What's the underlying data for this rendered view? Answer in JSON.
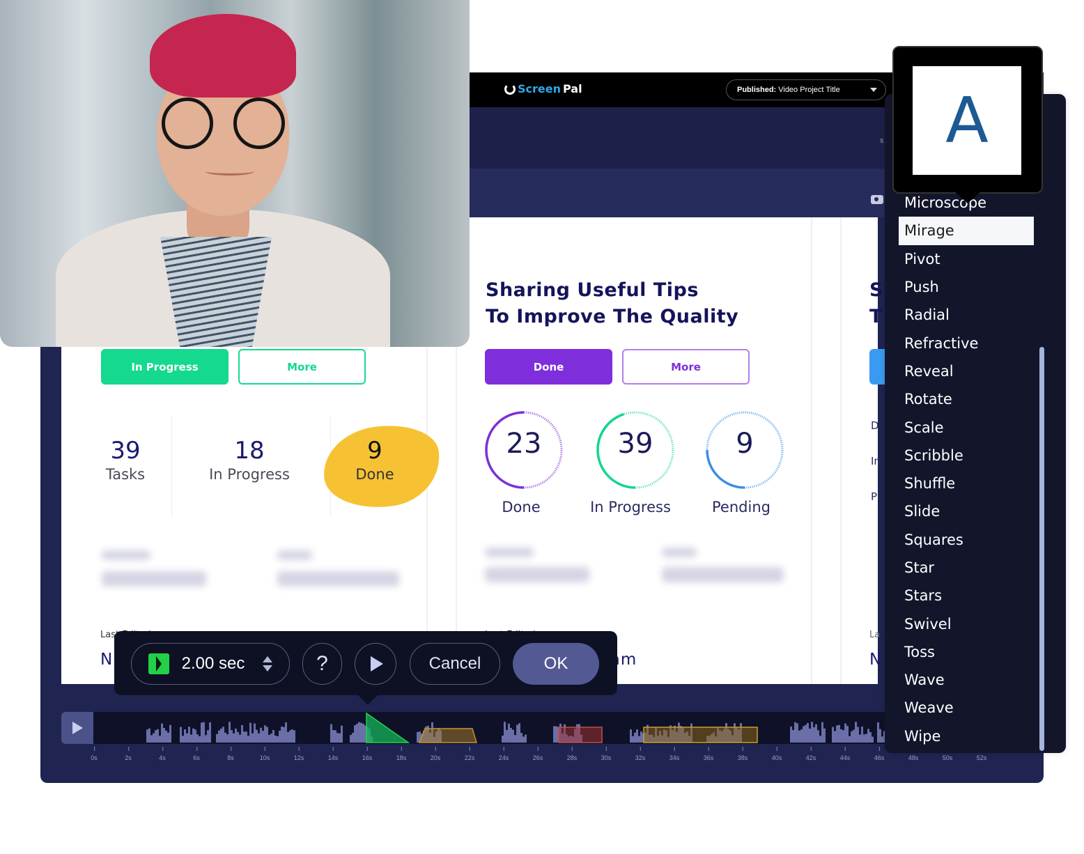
{
  "header": {
    "logo_brand_1": "Screen",
    "logo_brand_2": "Pal",
    "publish_prefix": "Published:",
    "publish_title": "Video Project Title",
    "small_label": "9."
  },
  "card1": {
    "primary_button": "In Progress",
    "secondary_button": "More",
    "stats": [
      {
        "value": "39",
        "label": "Tasks"
      },
      {
        "value": "18",
        "label": "In Progress"
      },
      {
        "value": "9",
        "label": "Done"
      }
    ],
    "last_edited_label": "Last Edited",
    "last_edited_value": "N"
  },
  "card2": {
    "title_line1": "Sharing Useful Tips",
    "title_line2": "To Improve The Quality",
    "primary_button": "Done",
    "secondary_button": "More",
    "rings": [
      {
        "value": "23",
        "label": "Done",
        "progress": 0.5,
        "color": "#7b2fd6"
      },
      {
        "value": "39",
        "label": "In Progress",
        "progress": 0.45,
        "color": "#13d68a"
      },
      {
        "value": "9",
        "label": "Pending",
        "progress": 0.25,
        "color": "#3a8fe0"
      }
    ],
    "last_edited_label": "Last Edited",
    "last_edited_value": "Uploaded by Sam"
  },
  "card3": {
    "title_initial_1": "S",
    "title_initial_2": "T",
    "stat_initials": [
      "D",
      "In",
      "P"
    ],
    "last_edited_label": "La",
    "last_edited_value": "N"
  },
  "colors": {
    "green": "#14d98f",
    "purple": "#7e2fdb",
    "highlight": "#f6c234",
    "app_bg": "#1f2450"
  },
  "transition_toolbar": {
    "duration": "2.00 sec",
    "help_label": "?",
    "cancel_label": "Cancel",
    "ok_label": "OK"
  },
  "timeline": {
    "ticks": [
      "0s",
      "2s",
      "4s",
      "6s",
      "8s",
      "10s",
      "12s",
      "14s",
      "16s",
      "18s",
      "20s",
      "22s",
      "24s",
      "26s",
      "28s",
      "30s",
      "32s",
      "34s",
      "36s",
      "38s",
      "40s",
      "42s",
      "44s",
      "46s",
      "48s",
      "50s",
      "52s"
    ]
  },
  "preview": {
    "letter": "A"
  },
  "transitions_menu": {
    "selected": "Mirage",
    "items": [
      "Microscope",
      "Mirage",
      "Pivot",
      "Push",
      "Radial",
      "Refractive",
      "Reveal",
      "Rotate",
      "Scale",
      "Scribble",
      "Shuffle",
      "Slide",
      "Squares",
      "Star",
      "Stars",
      "Swivel",
      "Toss",
      "Wave",
      "Weave",
      "Wipe"
    ]
  }
}
